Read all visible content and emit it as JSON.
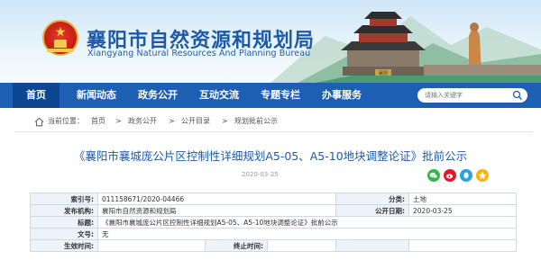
{
  "site": {
    "title_cn": "襄阳市自然资源和规划局",
    "title_en": "Xiangyang Natural Resources And Planning Bureau",
    "tower_plaque": "襄阳"
  },
  "nav": {
    "items": [
      "首页",
      "新闻动态",
      "政务公开",
      "互动交流",
      "专题专栏",
      "办事服务"
    ],
    "active_index": 0,
    "search_placeholder": "请输入关键字"
  },
  "breadcrumb": {
    "prefix": "当前位置：",
    "items": [
      "首页",
      "政务公开",
      "公开目录",
      "规划批前公示"
    ],
    "separator": ">"
  },
  "article": {
    "title": "《襄阳市襄城庞公片区控制性详细规划A5-05、A5-10地块调整论证》批前公示",
    "date": "2020-03-25"
  },
  "info_table": {
    "index_label": "索引号:",
    "index_value": "011158671/2020-04466",
    "category_label": "分类:",
    "category_value": "土地",
    "publisher_label": "发布机构:",
    "publisher_value": "襄阳市自然资源和规划局",
    "pubdate_label": "公开日期:",
    "pubdate_value": "2020-03-25",
    "title_label": "标题:",
    "title_value": "《襄阳市襄城庞公片区控制性详细规划A5-05、A5-10地块调整论证》批前公示",
    "docno_label": "文号:",
    "docno_value": "无",
    "effective_label": "生效时间:",
    "effective_value": "",
    "expire_label": "终止时间:",
    "expire_value": ""
  },
  "colors": {
    "brand_blue": "#1d5fb3",
    "nav_active": "#0e4791",
    "title_blue": "#1d5aa8",
    "share_wechat": "#3bb54a",
    "share_weibo": "#e6162d",
    "share_qq": "#2aa3e0"
  },
  "icons": [
    "national-emblem-icon",
    "home-icon",
    "search-icon",
    "wechat-share-icon",
    "weibo-share-icon",
    "qq-share-icon",
    "qzone-share-icon"
  ]
}
